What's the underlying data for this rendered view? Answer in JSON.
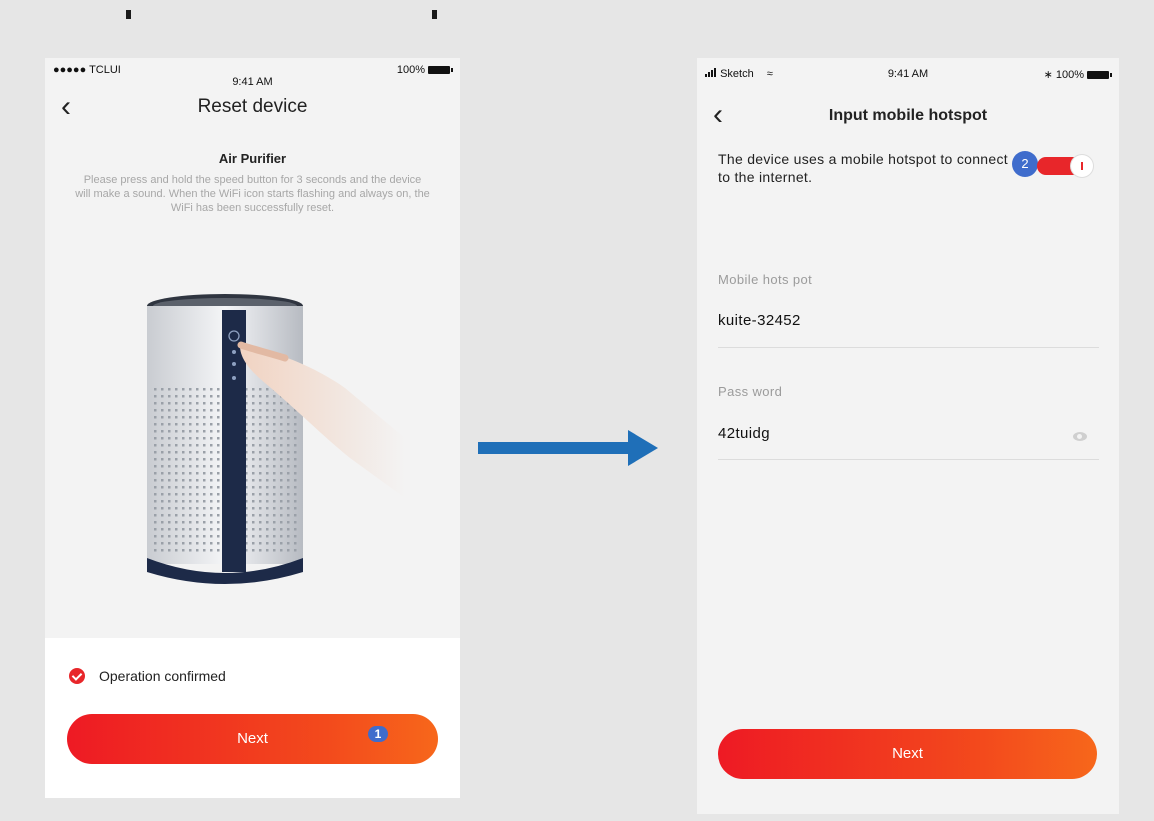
{
  "screen1": {
    "status": {
      "carrier": "●●●●● TCLUI",
      "time": "9:41 AM",
      "battery": "100%"
    },
    "nav": {
      "title": "Reset device"
    },
    "heading": "Air Purifier",
    "description": "Please press and hold the speed button for 3 seconds and the device will make a sound. When the WiFi icon starts flashing and always on, the WiFi has been successfully reset.",
    "confirm_label": "Operation confirmed",
    "next_label": "Next",
    "badge": "1"
  },
  "screen2": {
    "status": {
      "carrier": "Sketch",
      "time": "9:41 AM",
      "battery": "100%"
    },
    "nav": {
      "title": "Input mobile hotspot"
    },
    "description": "The device uses a mobile hotspot to connect to the internet.",
    "badge": "2",
    "hotspot": {
      "label": "Mobile hots pot",
      "value": "kuite-32452"
    },
    "password": {
      "label": "Pass word",
      "value": "42tuidg"
    },
    "next_label": "Next"
  },
  "colors": {
    "accent": "#e8262a",
    "badge": "#3f6ccc",
    "arrow": "#1f6fb8"
  }
}
